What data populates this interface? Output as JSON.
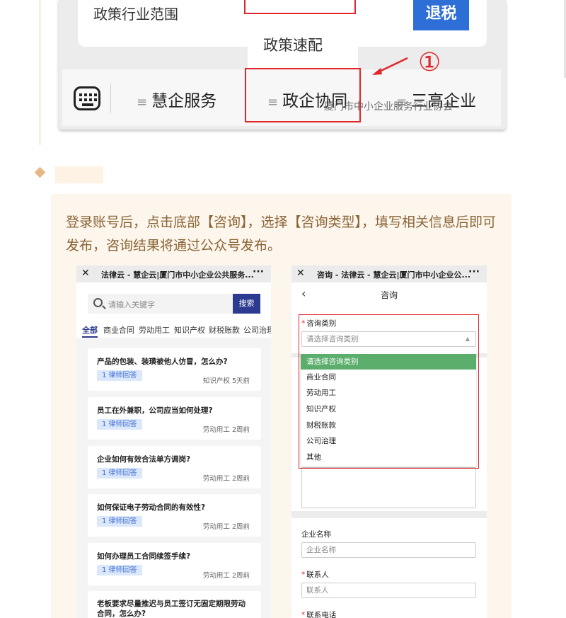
{
  "top_screenshot": {
    "policy_range_label": "政策行业范围",
    "tax_button_label": "退税",
    "popup_item_label": "政策速配",
    "annotation_number": "①",
    "menu": [
      {
        "label": "慧企服务"
      },
      {
        "label": "政企协同"
      },
      {
        "label": "三高企业"
      }
    ],
    "menu_prefix": "≡",
    "watermark": "厦门市中小企业服务行业协会"
  },
  "step": {
    "instruction": "登录账号后，点击底部【咨询】，选择【咨询类型】，填写相关信息后即可发布，咨询结果将通过公众号发布。"
  },
  "left_phone": {
    "close_symbol": "✕",
    "title": "法律云 - 慧企云|厦门市中小企业公共服务...",
    "more_symbol": "···",
    "search_placeholder": "请输入关键字",
    "search_button": "搜索",
    "tabs": [
      "全部",
      "商业合同",
      "劳动用工",
      "知识产权",
      "财税账款",
      "公司治理"
    ],
    "questions": [
      {
        "question": "产品的包装、装璜被他人仿冒，怎么办?",
        "badge": "1 律师回答",
        "meta": "知识产权 5天前"
      },
      {
        "question": "员工在外兼职，公司应当如何处理?",
        "badge": "1 律师回答",
        "meta": "劳动用工 2周前"
      },
      {
        "question": "企业如何有效合法单方调岗?",
        "badge": "1 律师回答",
        "meta": "劳动用工 2周前"
      },
      {
        "question": "如何保证电子劳动合同的有效性?",
        "badge": "1 律师回答",
        "meta": "劳动用工 2周前"
      },
      {
        "question": "如何办理员工合同续签手续?",
        "badge": "1 律师回答",
        "meta": "劳动用工 2周前"
      },
      {
        "question": "老板要求尽量推迟与员工签订无固定期限劳动合同，怎么办?",
        "badge": "",
        "meta": ""
      }
    ]
  },
  "right_phone": {
    "close_symbol": "✕",
    "title": "咨询 - 法律云 - 慧企云|厦门市中小企业公...",
    "more_symbol": "···",
    "back_symbol": "‹",
    "page_title": "咨询",
    "consult_type_label": "咨询类别",
    "consult_type_placeholder": "请选择咨询类别",
    "dropdown_options": [
      "请选择咨询类别",
      "商业合同",
      "劳动用工",
      "知识产权",
      "财税账款",
      "公司治理",
      "其他"
    ],
    "company_label": "企业名称",
    "company_placeholder": "企业名称",
    "contact_label": "联系人",
    "contact_placeholder": "联系人",
    "phone_label": "联系电话",
    "required_mark": "*"
  },
  "colors": {
    "annotation_red": "#e0262b",
    "tax_blue": "#2d6fd6",
    "search_navy": "#2c3a8f",
    "selected_green": "#5aad6b",
    "instruction_brown": "#8a6436",
    "step_bg": "#fdf6ec"
  }
}
